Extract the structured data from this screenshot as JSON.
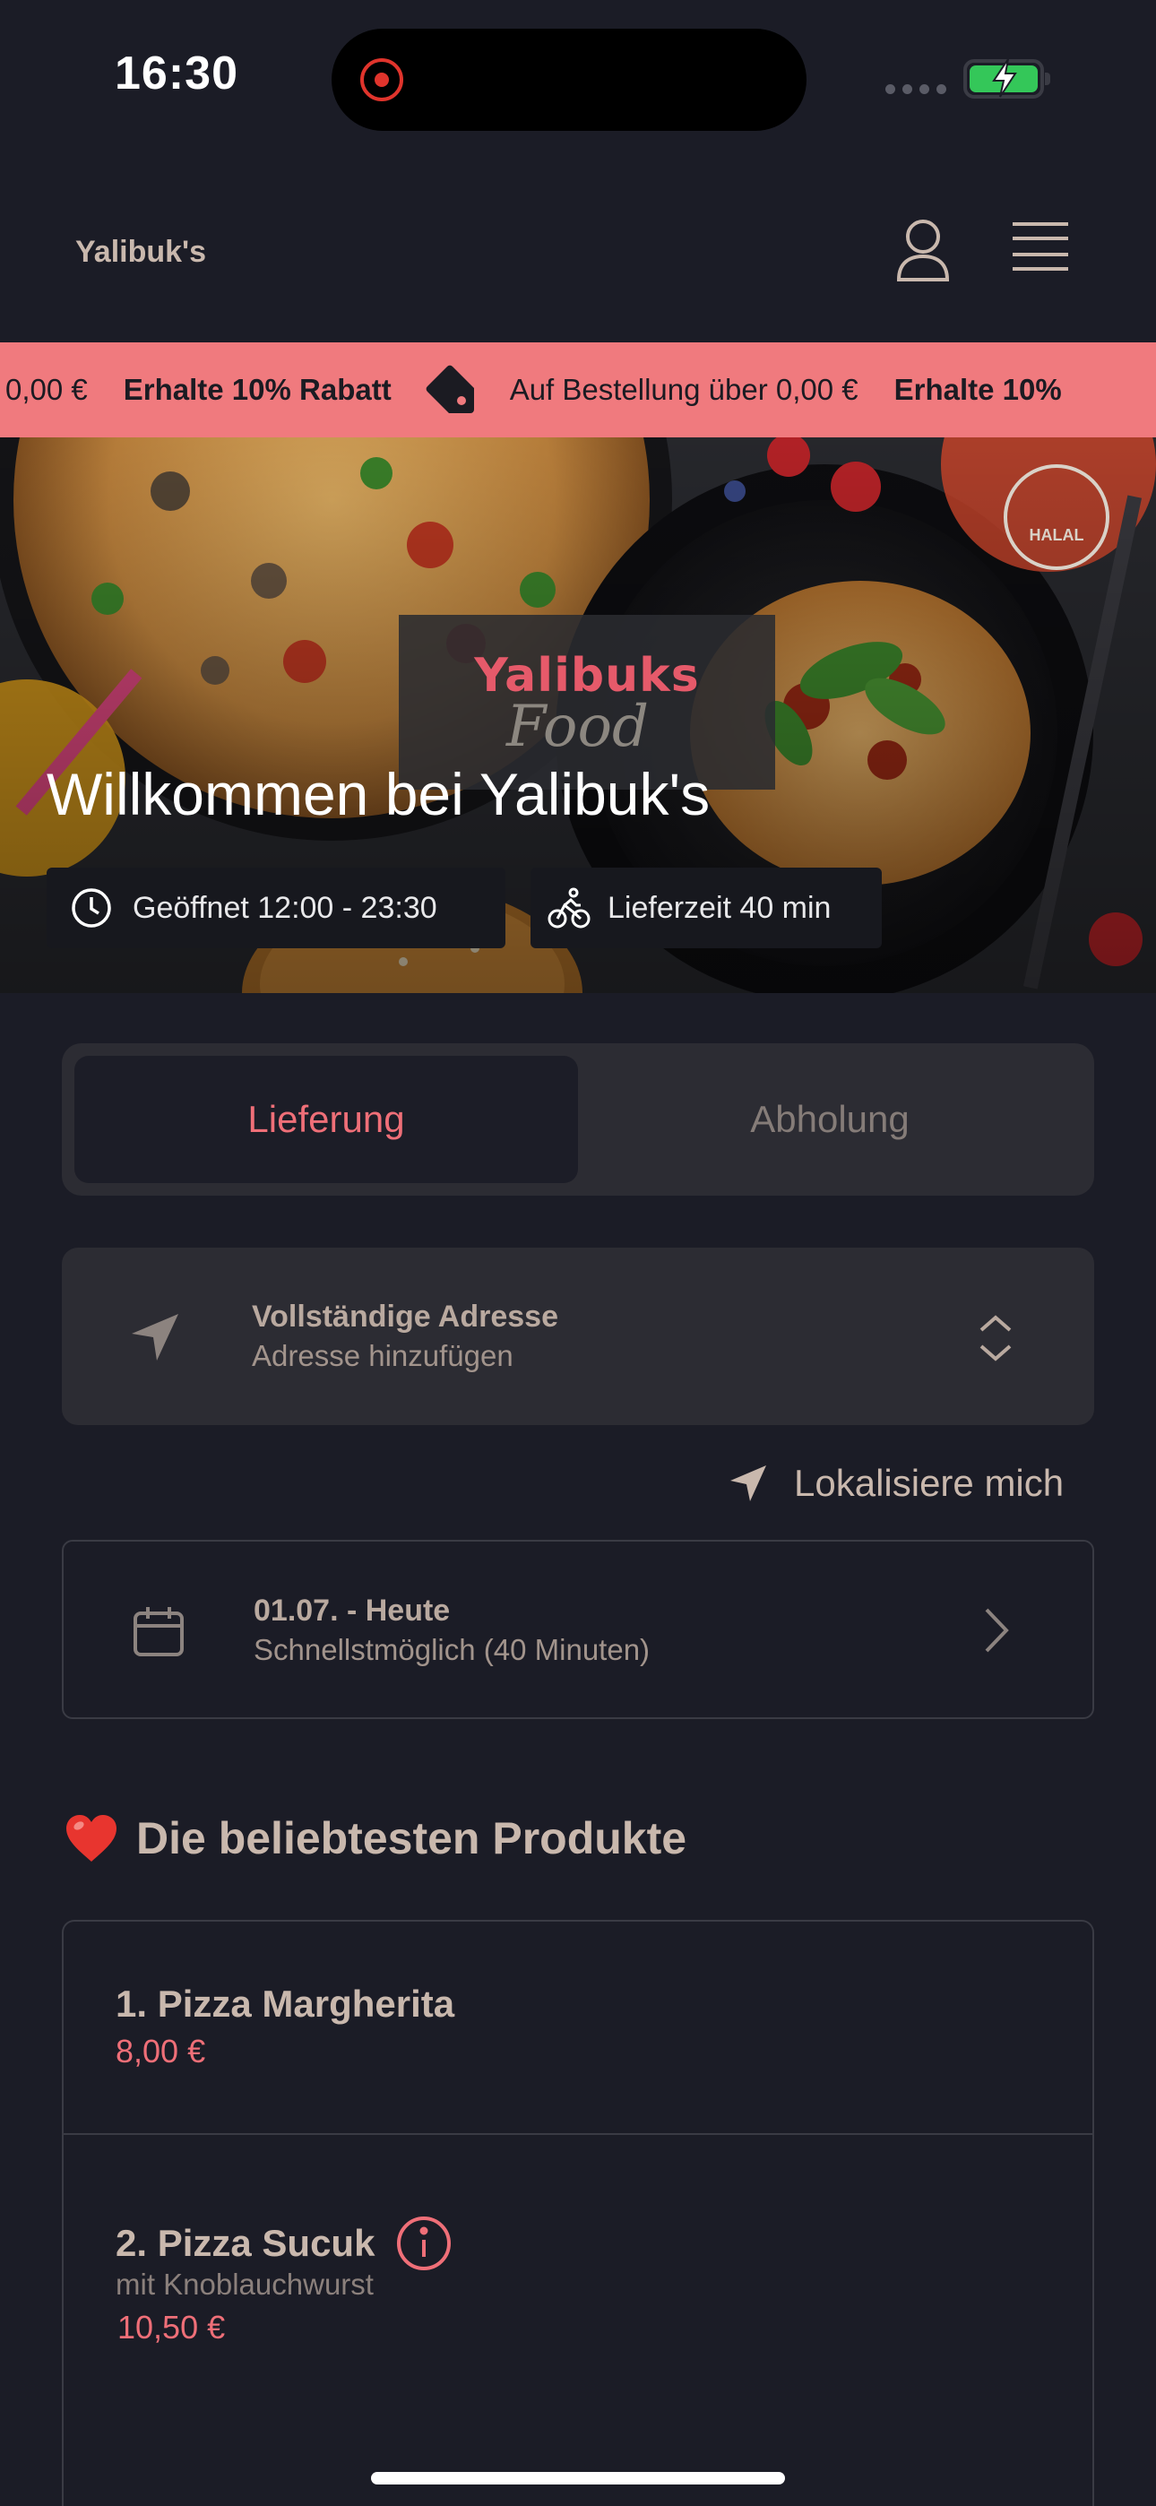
{
  "status_bar": {
    "time": "16:30"
  },
  "header": {
    "brand": "Yalibuk's"
  },
  "marquee": {
    "items": [
      {
        "text": "0,00 €"
      },
      {
        "bold": "Erhalte 10% Rabatt"
      },
      {
        "text": "Auf Bestellung über 0,00 €"
      },
      {
        "bold": "Erhalte 10%"
      }
    ]
  },
  "hero": {
    "logo_line1": "Yalibuks",
    "logo_line2": "Food",
    "halal_badge": "HALAL",
    "title": "Willkommen bei Yalibuk's",
    "opening_hours": "Geöffnet 12:00 - 23:30",
    "delivery_time": "Lieferzeit 40 min"
  },
  "tabs": {
    "delivery": "Lieferung",
    "pickup": "Abholung",
    "active": "delivery"
  },
  "address": {
    "title": "Vollständige Adresse",
    "subtitle": "Adresse hinzufügen"
  },
  "locate_label": "Lokalisiere mich",
  "date": {
    "title": "01.07. - Heute",
    "subtitle": "Schnellstmöglich (40 Minuten)"
  },
  "popular": {
    "title": "Die beliebtesten Produkte",
    "products": [
      {
        "name": "1. Pizza Margherita",
        "price": "8,00 €"
      },
      {
        "name": "2. Pizza Sucuk",
        "description": "mit Knoblauchwurst",
        "price": "10,50 €"
      }
    ]
  },
  "colors": {
    "background": "#1b1c26",
    "accent": "#ef6f78",
    "banner": "#f07a7e",
    "card": "#2c2c33",
    "text": "#c9b8ad"
  }
}
